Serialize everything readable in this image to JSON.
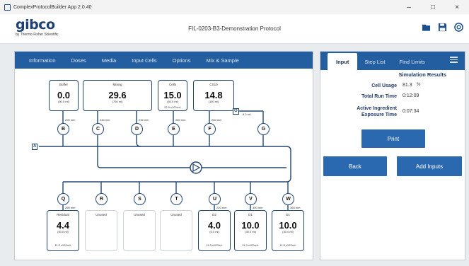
{
  "window": {
    "title": "ComplexProtocolBuilder App 2.0.40",
    "controls": [
      "–",
      "□",
      "×"
    ]
  },
  "header": {
    "brand": "gibco",
    "brand_sub": "by Thermo Fisher Scientific",
    "protocol_title": "FIL-0203-B3-Demonstration Protocol",
    "icons": [
      "folder-icon",
      "save-icon",
      "help-icon"
    ]
  },
  "left_tabs": [
    "Information",
    "Doses",
    "Media",
    "Input Cells",
    "Options",
    "Mix & Sample"
  ],
  "right_tabs": {
    "input": "Input",
    "step_list": "Step List",
    "find_limits": "Find Limits"
  },
  "results": {
    "heading": "Simulation Results",
    "rows": [
      {
        "label": "Cell Usage",
        "value": "81.3",
        "unit": "%"
      },
      {
        "label": "Total Run Time",
        "value": "0:12:09",
        "unit": ""
      },
      {
        "label": "Active Ingredient Exposure Time",
        "value": "0:07:34",
        "unit": ""
      }
    ]
  },
  "buttons": {
    "print": "Print",
    "back": "Back",
    "add_inputs": "Add Inputs"
  },
  "top_boxes": [
    {
      "name": "Buffer",
      "value": "0.0",
      "sub": "(50.0 ml)",
      "conc": ""
    },
    {
      "name": "Mixing",
      "value": "29.6",
      "sub": "(750 ml)",
      "conc": ""
    },
    {
      "name": "Cells",
      "value": "15.0",
      "sub": "(50.0 ml)",
      "conc": "22.0 x10⁶/mL"
    },
    {
      "name": "CS10",
      "value": "14.8",
      "sub": "(150 ml)",
      "conc": ""
    }
  ],
  "top_nodes": [
    "B",
    "C",
    "D",
    "E",
    "F",
    "G"
  ],
  "top_lengths": [
    "200 mm",
    "240 mm",
    "240 mm",
    "260 mm",
    "260 mm",
    "8.2 mL"
  ],
  "tags": {
    "a": "A",
    "o": "O"
  },
  "bottom_nodes": [
    "Q",
    "R",
    "S",
    "T",
    "U",
    "V",
    "W"
  ],
  "bottom_lengths": [
    "260 mm",
    "220 mm",
    "300 mm",
    "360 mm"
  ],
  "bottom_boxes": [
    {
      "name": "Residual",
      "value": "4.4",
      "sub": "(50.0 ml)",
      "conc": "11.0 x10⁶/mL",
      "unlisted": false
    },
    {
      "name": "Unused",
      "value": "",
      "sub": "",
      "conc": "",
      "unlisted": true
    },
    {
      "name": "Unused",
      "value": "",
      "sub": "",
      "conc": "",
      "unlisted": true
    },
    {
      "name": "Unused",
      "value": "",
      "sub": "",
      "conc": "",
      "unlisted": true
    },
    {
      "name": "D2",
      "value": "4.0",
      "sub": "(5.0 ml)",
      "conc": "11.0 x10⁶/mL",
      "unlisted": false
    },
    {
      "name": "D1",
      "value": "10.0",
      "sub": "(30.0 ml)",
      "conc": "11.0 x10⁶/mL",
      "unlisted": false
    },
    {
      "name": "D1",
      "value": "10.0",
      "sub": "(30.0 ml)",
      "conc": "11.0 x10⁶/mL",
      "unlisted": false
    }
  ],
  "colors": {
    "accent": "#235fa0",
    "line": "#23466f",
    "button": "#2a69b0"
  }
}
